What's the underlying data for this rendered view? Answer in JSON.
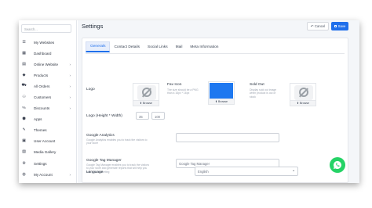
{
  "search": {
    "placeholder": "Search..."
  },
  "sidebar": {
    "items": [
      {
        "label": "My Websites",
        "icon": "menu-icon",
        "glyph": "☰",
        "has_chevron": false
      },
      {
        "label": "Dashboard",
        "icon": "dashboard-icon",
        "glyph": "▦",
        "has_chevron": false
      },
      {
        "label": "Online Website",
        "icon": "store-icon",
        "glyph": "▤",
        "has_chevron": true
      },
      {
        "label": "Products",
        "icon": "box-icon",
        "glyph": "◆",
        "has_chevron": true
      },
      {
        "label": "All Orders",
        "icon": "cart-icon",
        "glyph": "⛟",
        "has_chevron": true
      },
      {
        "label": "Customers",
        "icon": "customers-icon",
        "glyph": "⚇",
        "has_chevron": true
      },
      {
        "label": "Discounts",
        "icon": "discount-icon",
        "glyph": "%",
        "has_chevron": true
      },
      {
        "label": "Apps",
        "icon": "apps-icon",
        "glyph": "⬢",
        "has_chevron": false
      },
      {
        "label": "Themes",
        "icon": "brush-icon",
        "glyph": "✎",
        "has_chevron": false
      },
      {
        "label": "User Account",
        "icon": "user-icon",
        "glyph": "▣",
        "has_chevron": false
      },
      {
        "label": "Media Gallery",
        "icon": "gallery-icon",
        "glyph": "▧",
        "has_chevron": false
      },
      {
        "label": "Settings",
        "icon": "gear-icon",
        "glyph": "⚙",
        "has_chevron": false
      },
      {
        "label": "My Account",
        "icon": "account-icon",
        "glyph": "◍",
        "has_chevron": true
      }
    ]
  },
  "header": {
    "title": "Settings",
    "cancel_label": "Cancel",
    "save_label": "Save"
  },
  "tabs": [
    {
      "label": "Generals",
      "active": true
    },
    {
      "label": "Contact Details",
      "active": false
    },
    {
      "label": "Social Links",
      "active": false
    },
    {
      "label": "Mail",
      "active": false
    },
    {
      "label": "Meta Information",
      "active": false
    }
  ],
  "general": {
    "logo_label": "Logo",
    "browse_label": "Browse",
    "fav_icon_label": "Fav Icon",
    "fav_icon_help": "The size should be a PNG than a 16px * 16px",
    "fav_icon_color": "#1e78f0",
    "sold_out_label": "Sold Out",
    "sold_out_help": "Display sold out image when product is out of stock",
    "logo_size_label": "Logo (Height * Width)",
    "logo_height": "35",
    "logo_width": "100",
    "ga_label": "Google Analytics",
    "ga_help": "Google Analytics enables you to track the visitors to your store",
    "ga_value": "",
    "gtm_label": "Google Tag Manager",
    "gtm_help": "Google Tag Manager enables you to track the visitors to your store and generate reports that will help you with your marketing",
    "gtm_placeholder": "Google Tag Manager",
    "language_label": "Language",
    "language_value": "English"
  },
  "colors": {
    "accent": "#1f6feb",
    "whatsapp": "#25d366"
  }
}
